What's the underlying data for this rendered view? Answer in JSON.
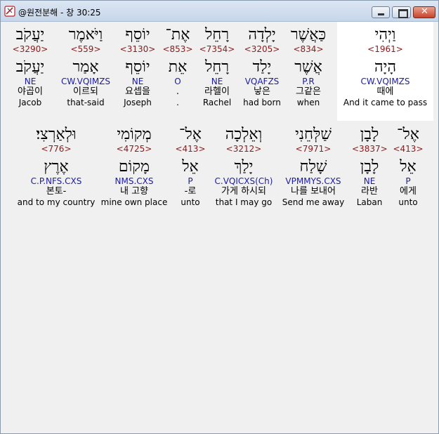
{
  "window": {
    "title": "@원전분해 - 창 30:25"
  },
  "verse": {
    "row1": [
      {
        "id": "w1",
        "surface": "וַיְהִי",
        "strong": "<1961>",
        "lemma": "הָיָה",
        "morph": "CW.VQIMZS",
        "korean": "때에",
        "english": "And it came to pass"
      },
      {
        "id": "w2",
        "surface": "כַּאֲשֶׁר",
        "strong": "<834>",
        "lemma": "אֲשֶׁר",
        "morph": "P.R",
        "korean": "그같은",
        "english": "when"
      },
      {
        "id": "w3",
        "surface": "יָלְדָה",
        "strong": "<3205>",
        "lemma": "יָלַד",
        "morph": "VQAFZS",
        "korean": "낳은",
        "english": "had born"
      },
      {
        "id": "w4",
        "surface": "רָחֵל",
        "strong": "<7354>",
        "lemma": "רָחֵל",
        "morph": "NE",
        "korean": "라헬이",
        "english": "Rachel"
      },
      {
        "id": "w5",
        "surface": "אֶת־",
        "strong": "<853>",
        "lemma": "אֵת",
        "morph": "O",
        "korean": ".",
        "english": "."
      },
      {
        "id": "w6",
        "surface": "יוֹסֵף",
        "strong": "<3130>",
        "lemma": "יוֹסֵף",
        "morph": "NE",
        "korean": "요셉을",
        "english": "Joseph"
      },
      {
        "id": "w7",
        "surface": "וַיֹּאמֶר",
        "strong": "<559>",
        "lemma": "אָמַר",
        "morph": "CW.VQIMZS",
        "korean": "이르되",
        "english": "that-said"
      },
      {
        "id": "w8",
        "surface": "יַעֲקֹב",
        "strong": "<3290>",
        "lemma": "יַעֲקֹב",
        "morph": "NE",
        "korean": "야곱이",
        "english": "Jacob"
      }
    ],
    "row2": [
      {
        "id": "w9",
        "surface": "אֶל־",
        "strong": "<413>",
        "lemma": "אֵל",
        "morph": "P",
        "korean": "에게",
        "english": "unto"
      },
      {
        "id": "w10",
        "surface": "לָבָן",
        "strong": "<3837>",
        "lemma": "לָבָן",
        "morph": "NE",
        "korean": "라반",
        "english": "Laban"
      },
      {
        "id": "w11",
        "surface": "שַׁלְּחֵנִי",
        "strong": "<7971>",
        "lemma": "שָׁלַח",
        "morph": "VPMMYS.CXS",
        "korean": "나를 보내어",
        "english": "Send me away"
      },
      {
        "id": "w12",
        "surface": "וְאֵלְכָה",
        "strong": "<3212>",
        "lemma": "יָלַךְ",
        "morph": "C.VQICXS(Ch)",
        "korean": "가게 하시되",
        "english": "that I may go"
      },
      {
        "id": "w13",
        "surface": "אֶל־",
        "strong": "<413>",
        "lemma": "אֵל",
        "morph": "P",
        "korean": "-로",
        "english": "unto"
      },
      {
        "id": "w14",
        "surface": "מְקוֹמִי",
        "strong": "<4725>",
        "lemma": "מָקוֹם",
        "morph": "NMS.CXS",
        "korean": "내 고향",
        "english": "mine own place"
      },
      {
        "id": "w15",
        "surface": "וּלְאַרְצִי׃",
        "strong": "<776>",
        "lemma": "אֶרֶץ",
        "morph": "C.P.NFS.CXS",
        "korean": "본토-",
        "english": "and to my country"
      }
    ]
  }
}
